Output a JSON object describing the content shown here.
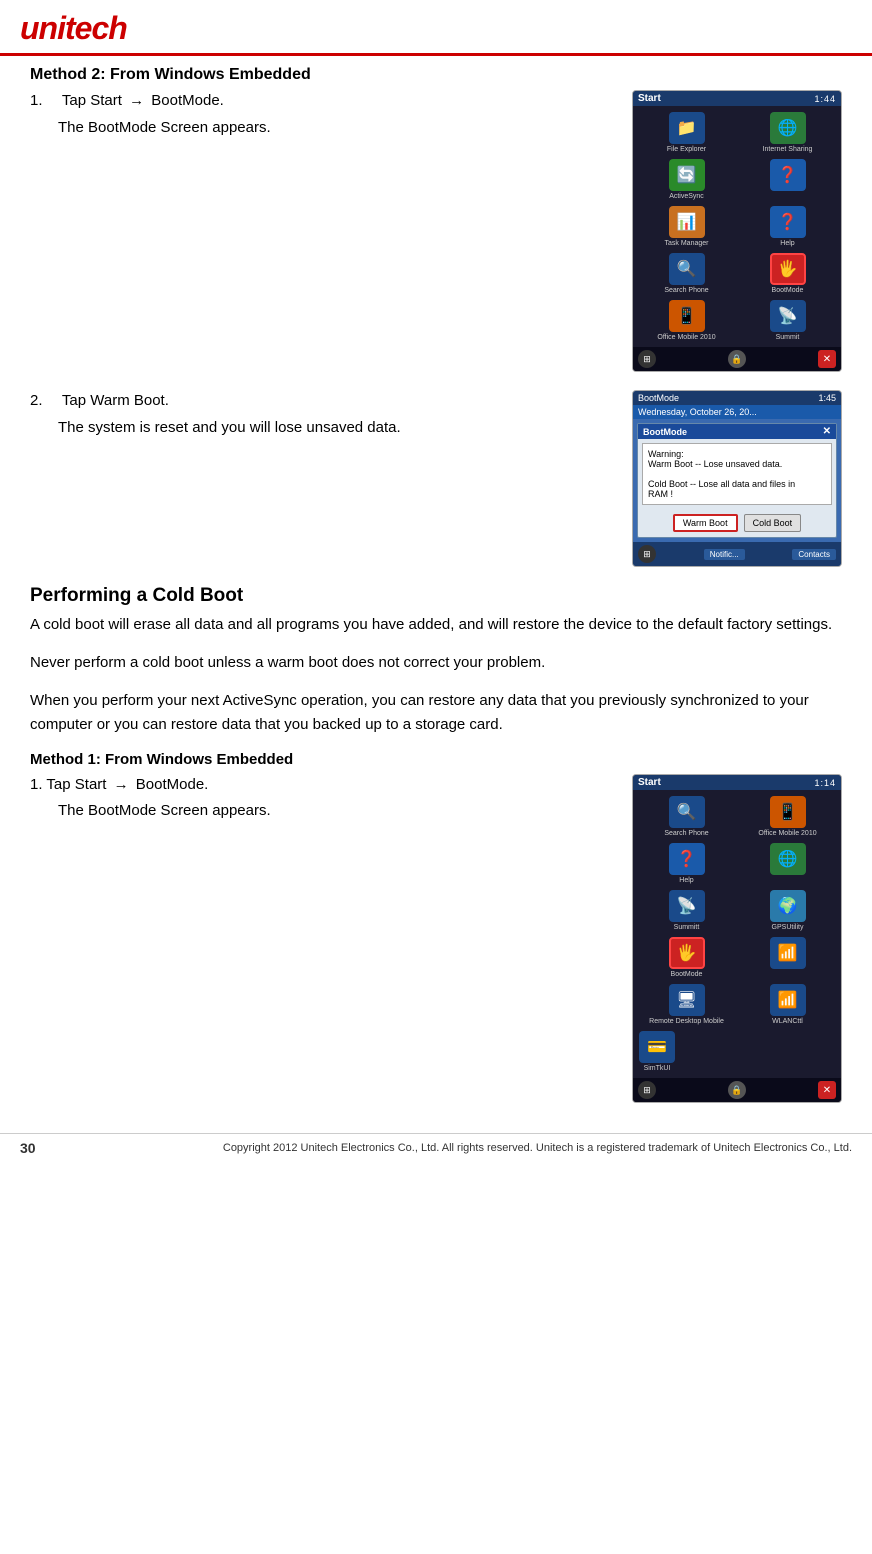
{
  "header": {
    "logo": "unitech",
    "logo_color": "#cc0000"
  },
  "page": {
    "number": "30"
  },
  "footer": {
    "copyright": "Copyright 2012 Unitech Electronics Co., Ltd. All rights reserved. Unitech is a registered trademark of Unitech Electronics Co., Ltd."
  },
  "section_warm_boot": {
    "heading": "Method 2: From Windows Embedded",
    "step1_num": "1.",
    "step1_label": "Tap Start",
    "step1_arrow": "→",
    "step1_action": "BootMode.",
    "step1_detail": "The BootMode Screen appears.",
    "step2_num": "2.",
    "step2_label": "Tap Warm Boot.",
    "step2_detail": "The system is reset and you will lose unsaved data."
  },
  "phone1": {
    "title": "Start",
    "time": "1:44",
    "icons": [
      {
        "label": "File Explorer",
        "type": "blue-dark",
        "icon": "📁"
      },
      {
        "label": "Internet Sharing",
        "type": "blue",
        "icon": "🌐"
      },
      {
        "label": "ActiveSync",
        "type": "green",
        "icon": "🔄"
      },
      {
        "label": "",
        "type": "blue",
        "icon": "❓"
      },
      {
        "label": "Task Manager",
        "type": "orange",
        "icon": "📊"
      },
      {
        "label": "Help",
        "type": "blue",
        "icon": "❓"
      },
      {
        "label": "Search Phone",
        "type": "blue-dark",
        "icon": "🔍"
      },
      {
        "label": "BootMode",
        "type": "highlighted",
        "icon": "🖐"
      },
      {
        "label": "Office Mobile 2010",
        "type": "blue",
        "icon": "📱"
      },
      {
        "label": "Summit",
        "type": "blue-dark",
        "icon": "📡"
      }
    ]
  },
  "phone2_bootmode": {
    "title": "BootMode",
    "time": "1:45",
    "date": "Wednesday, October 26, 20...",
    "dialog_title": "BootMode",
    "warning_line1": "Warning:",
    "warning_line2": "Warm Boot -- Lose unsaved data.",
    "warning_line3": "",
    "warning_line4": "Cold Boot -- Lose all data and files in",
    "warning_line5": "RAM !",
    "btn_warm": "Warm Boot",
    "btn_cold": "Cold Boot",
    "softkey_left": "Notific...",
    "softkey_right": "Contacts"
  },
  "section_cold_boot": {
    "performing_heading": "Performing a Cold Boot",
    "para1": "A cold boot will erase all data and all programs you have added, and will restore the device to the default factory settings.",
    "para2": "Never perform a cold boot unless a warm boot does not correct your problem.",
    "para3": "When you perform your next ActiveSync operation, you can restore any data that you previously synchronized to your computer or you can restore data that you backed up to a storage card.",
    "method_heading": "Method 1: From Windows Embedded",
    "step1_num": "1.",
    "step1_label": "Tap Start",
    "step1_arrow": "→",
    "step1_action": "BootMode.",
    "step1_detail": "The BootMode Screen appears."
  },
  "phone3": {
    "title": "Start",
    "time": "1:14",
    "icons": [
      {
        "label": "Search Phone",
        "type": "blue-dark",
        "icon": "🔍"
      },
      {
        "label": "Office Mobile 2010",
        "type": "blue",
        "icon": "📱"
      },
      {
        "label": "Help",
        "type": "blue",
        "icon": "❓"
      },
      {
        "label": "",
        "type": "blue",
        "icon": "🌐"
      },
      {
        "label": "Summitt",
        "type": "blue-dark",
        "icon": "📡"
      },
      {
        "label": "GPSUtility",
        "type": "blue",
        "icon": "🌍"
      },
      {
        "label": "BootMode",
        "type": "highlighted",
        "icon": "🖐"
      },
      {
        "label": "",
        "type": "blue",
        "icon": "📶"
      },
      {
        "label": "Remote Desktop Mobile",
        "type": "blue-dark",
        "icon": "🖥"
      },
      {
        "label": "WLANCttl",
        "type": "blue",
        "icon": "📶"
      },
      {
        "label": "SimTkUI",
        "type": "blue-dark",
        "icon": "💳"
      }
    ]
  }
}
